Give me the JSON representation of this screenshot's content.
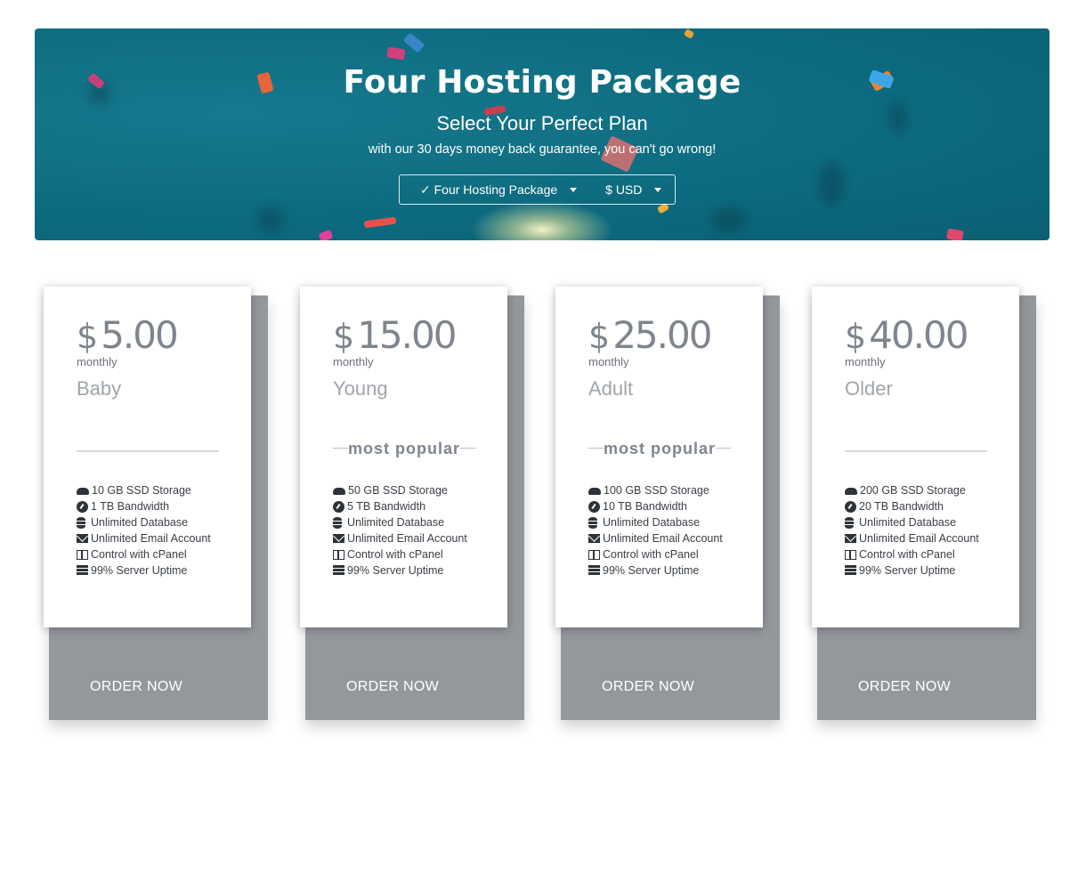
{
  "hero": {
    "title": "Four Hosting Package",
    "subtitle": "Select Your Perfect Plan",
    "note": "with our 30 days money back guarantee, you can't go wrong!",
    "package_select": "✓ Four Hosting Package",
    "currency_select": "$ USD"
  },
  "plans": [
    {
      "currency": "$",
      "price": "5.00",
      "period": "monthly",
      "name": "Baby",
      "popular": "",
      "features": [
        "10 GB SSD Storage",
        "1 TB Bandwidth",
        "Unlimited Database",
        "Unlimited Email Account",
        "Control with cPanel",
        "99% Server Uptime"
      ],
      "order": "ORDER NOW"
    },
    {
      "currency": "$",
      "price": "15.00",
      "period": "monthly",
      "name": "Young",
      "popular": "most popular",
      "features": [
        "50 GB SSD Storage",
        "5 TB Bandwidth",
        "Unlimited Database",
        "Unlimited Email Account",
        "Control with cPanel",
        "99% Server Uptime"
      ],
      "order": "ORDER NOW"
    },
    {
      "currency": "$",
      "price": "25.00",
      "period": "monthly",
      "name": "Adult",
      "popular": "most popular",
      "features": [
        "100 GB SSD Storage",
        "10 TB Bandwidth",
        "Unlimited Database",
        "Unlimited Email Account",
        "Control with cPanel",
        "99% Server Uptime"
      ],
      "order": "ORDER NOW"
    },
    {
      "currency": "$",
      "price": "40.00",
      "period": "monthly",
      "name": "Older",
      "popular": "",
      "features": [
        "200 GB SSD Storage",
        "20 TB Bandwidth",
        "Unlimited Database",
        "Unlimited Email Account",
        "Control with cPanel",
        "99% Server Uptime"
      ],
      "order": "ORDER NOW"
    }
  ],
  "feature_icons": [
    "hdd-icon",
    "gauge-icon",
    "database-icon",
    "envelope-icon",
    "columns-icon",
    "server-icon"
  ],
  "colors": {
    "hero_bg": "#0d6a7e",
    "card_back": "#94979c",
    "price_text": "#7e858d"
  }
}
